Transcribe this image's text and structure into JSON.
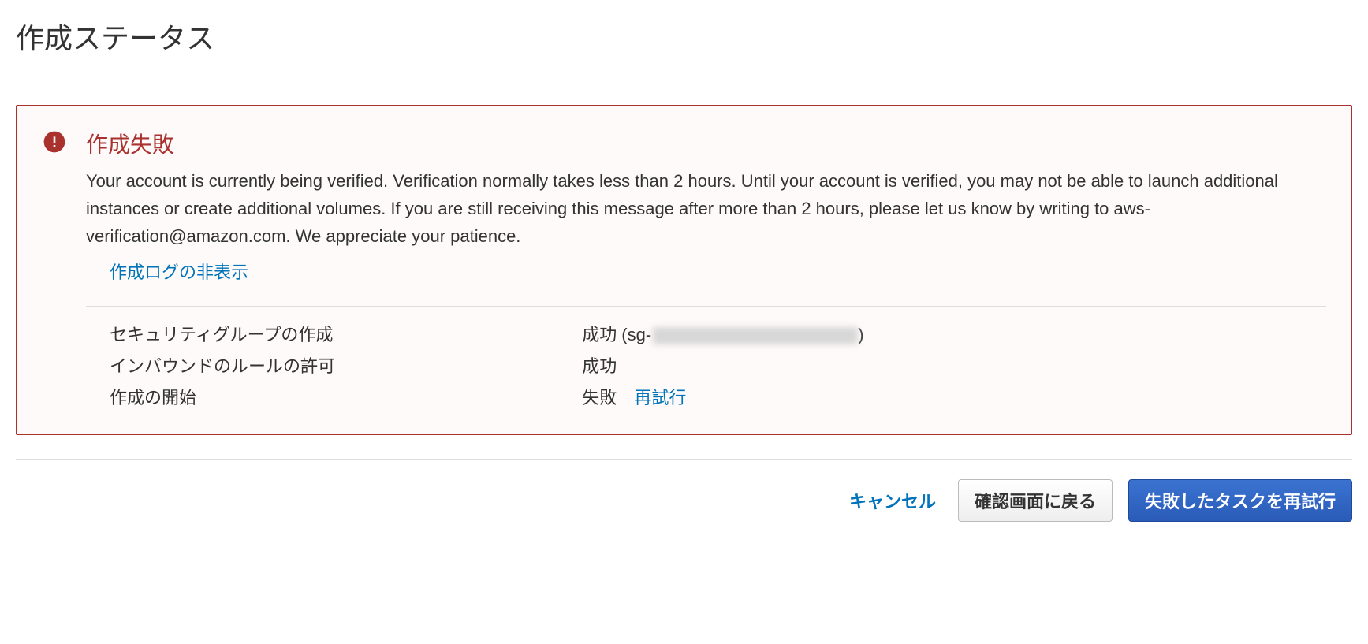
{
  "header": {
    "title": "作成ステータス"
  },
  "alert": {
    "title": "作成失敗",
    "message": "Your account is currently being verified. Verification normally takes less than 2 hours. Until your account is verified, you may not be able to launch additional instances or create additional volumes. If you are still receiving this message after more than 2 hours, please let us know by writing to aws-verification@amazon.com. We appreciate your patience.",
    "toggle_log": "作成ログの非表示",
    "log": {
      "rows": [
        {
          "label": "セキュリティグループの作成",
          "status": "成功 (sg-",
          "redacted": true,
          "suffix": ")"
        },
        {
          "label": "インバウンドのルールの許可",
          "status": "成功"
        },
        {
          "label": "作成の開始",
          "status": "失敗",
          "retry": "再試行"
        }
      ]
    }
  },
  "footer": {
    "cancel": "キャンセル",
    "back": "確認画面に戻る",
    "retry_failed": "失敗したタスクを再試行"
  }
}
